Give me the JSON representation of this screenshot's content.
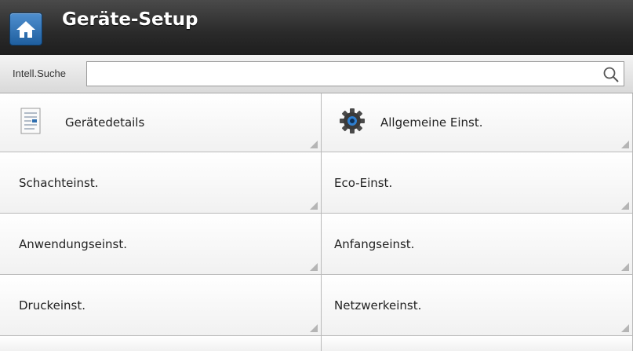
{
  "header": {
    "title": "Geräte-Setup",
    "home_icon": "home-icon"
  },
  "search": {
    "label": "Intell.Suche",
    "value": "",
    "icon": "search-icon"
  },
  "tiles": [
    {
      "label": "Gerätedetails",
      "icon": "document-icon"
    },
    {
      "label": "Allgemeine Einst.",
      "icon": "gear-icon"
    },
    {
      "label": "Schachteinst."
    },
    {
      "label": "Eco-Einst."
    },
    {
      "label": "Anwendungseinst."
    },
    {
      "label": "Anfangseinst."
    },
    {
      "label": "Druckeinst."
    },
    {
      "label": "Netzwerkeinst."
    }
  ],
  "colors": {
    "header_bg": "#2a2a2a",
    "home_button": "#2f6fb0",
    "tile_bg": "#ffffff",
    "divider": "#b9b9b9"
  }
}
